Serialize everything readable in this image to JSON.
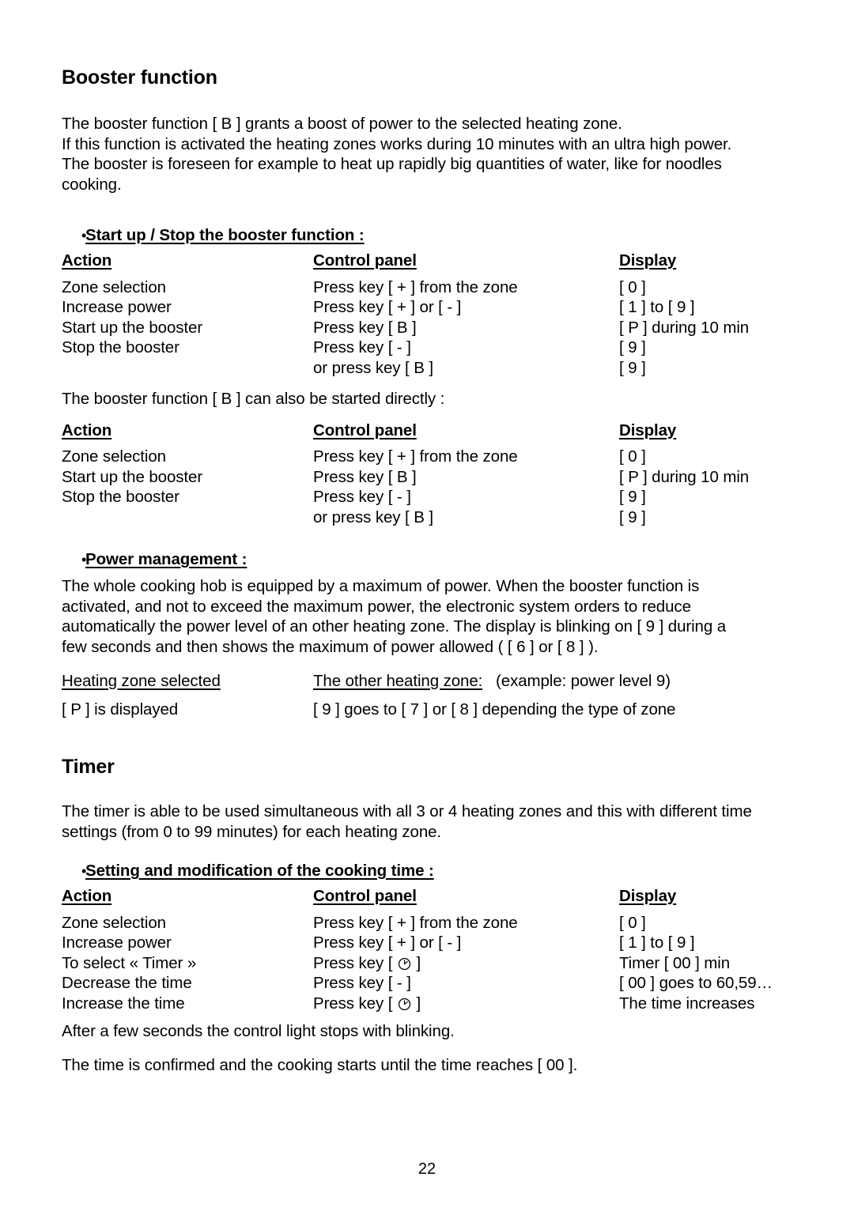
{
  "document": {
    "page_number": "22"
  },
  "booster": {
    "title": "Booster function",
    "intro_lines": [
      "The booster function [ B ] grants a boost of power to the  selected heating zone.",
      "If this function is activated the heating zones works during 10 minutes with an ultra high power.",
      "The booster is foreseen for example to heat up rapidly big quantities of water, like for noodles",
      "cooking."
    ],
    "bullet1": {
      "marker": "•",
      "label": "Start up / Stop the booster  function :"
    },
    "table1": {
      "headers": {
        "action": "Action",
        "control_panel": "Control panel",
        "display": "Display"
      },
      "rows": [
        {
          "action": "Zone selection",
          "control_panel": "Press key [ + ] from the zone",
          "display": "[ 0 ]"
        },
        {
          "action": "Increase power",
          "control_panel": "Press key [ + ] or [ - ]",
          "display": "[ 1 ] to [ 9 ]"
        },
        {
          "action": "Start up the booster",
          "control_panel": "Press key [ B ]",
          "display": "[ P ] during 10 min"
        },
        {
          "action": "Stop the booster",
          "control_panel": "Press key [ - ]",
          "display": "[ 9 ]"
        },
        {
          "action": "",
          "control_panel": "or press key [ B ]",
          "display": "[ 9 ]"
        }
      ]
    },
    "direct_note": "The booster function [ B ] can also be started directly :",
    "table2": {
      "headers": {
        "action": "Action",
        "control_panel": "Control panel",
        "display": "Display"
      },
      "rows": [
        {
          "action": "Zone selection",
          "control_panel": "Press key [ + ] from the zone",
          "display": "[ 0 ]"
        },
        {
          "action": "Start up the booster",
          "control_panel": "Press key [ B ]",
          "display": "[ P ] during 10 min"
        },
        {
          "action": "Stop the booster",
          "control_panel": "Press key [ - ]",
          "display": "[ 9 ]"
        },
        {
          "action": "",
          "control_panel": "or press key [ B ]",
          "display": "[ 9 ]"
        }
      ]
    },
    "bullet2": {
      "marker": "•",
      "label": "Power management :"
    },
    "power_lines": [
      "The whole cooking hob is equipped by a maximum of power. When the booster function is",
      "activated, and not to exceed the maximum power, the electronic system orders to reduce",
      "automatically the power level of an other heating zone. The display is blinking on [ 9 ] during a",
      "few seconds and then shows the maximum of power allowed ( [ 6 ] or [ 8 ] )."
    ],
    "power_table": {
      "header_left": "Heating zone selected",
      "header_right_underlined": "The other heating zone:",
      "header_right_plain": "(example: power  level 9)",
      "row_left": "[ P ] is displayed",
      "row_right": "[ 9 ] goes to [ 7 ] or [ 8 ] depending the type of zone"
    }
  },
  "timer": {
    "title": "Timer",
    "intro_lines": [
      "The timer is able to be used simultaneous with all 3 or 4 heating zones and this with different time",
      "settings (from 0 to 99 minutes) for each heating zone."
    ],
    "bullet3": {
      "marker": "•",
      "label": "Setting and modification of the cooking time :"
    },
    "table3": {
      "headers": {
        "action": "Action",
        "control_panel": "Control panel",
        "display": "Display"
      },
      "rows": [
        {
          "action": "Zone selection",
          "control_panel_pre": "Press key [ + ] from the zone",
          "icon": "",
          "control_panel_post": "",
          "display": "[ 0 ]"
        },
        {
          "action": "Increase power",
          "control_panel_pre": "Press key [ + ] or [ - ]",
          "icon": "",
          "control_panel_post": "",
          "display": "[ 1 ] to [ 9 ]"
        },
        {
          "action": "To select « Timer »",
          "control_panel_pre": "Press key [ ",
          "icon": "clock-icon",
          "control_panel_post": " ]",
          "display": "Timer [ 00 ] min"
        },
        {
          "action": "Decrease the time",
          "control_panel_pre": "Press key [ - ]",
          "icon": "",
          "control_panel_post": "",
          "display": "[ 00 ] goes to 60,59…"
        },
        {
          "action": "Increase the time",
          "control_panel_pre": "Press key [ ",
          "icon": "clock-icon",
          "control_panel_post": " ]",
          "display": "The time increases"
        }
      ]
    },
    "closing_lines": [
      "After a few seconds the control light stops with blinking.",
      "The time is confirmed and the cooking starts until the time reaches [ 00 ]."
    ]
  }
}
